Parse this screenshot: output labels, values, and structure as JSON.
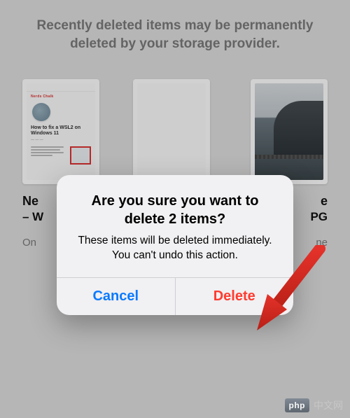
{
  "header": {
    "text": "Recently deleted items may be permanently deleted by your storage provider."
  },
  "items": [
    {
      "name_fragment": "Ne",
      "sub_fragment": "– W",
      "location_fragment": "On"
    },
    {
      "name_fragment": "",
      "sub_fragment": "",
      "location_fragment": ""
    },
    {
      "name_fragment": "e",
      "sub_fragment": "PG",
      "location_fragment": "ne"
    }
  ],
  "dialog": {
    "title": "Are you sure you want to delete 2 items?",
    "message": "These items will be deleted immediately. You can't undo this action.",
    "cancel_label": "Cancel",
    "delete_label": "Delete"
  },
  "watermark": {
    "badge": "php",
    "text": "中文网"
  },
  "colors": {
    "ios_blue": "#0a7aff",
    "ios_red": "#ff3b30"
  }
}
